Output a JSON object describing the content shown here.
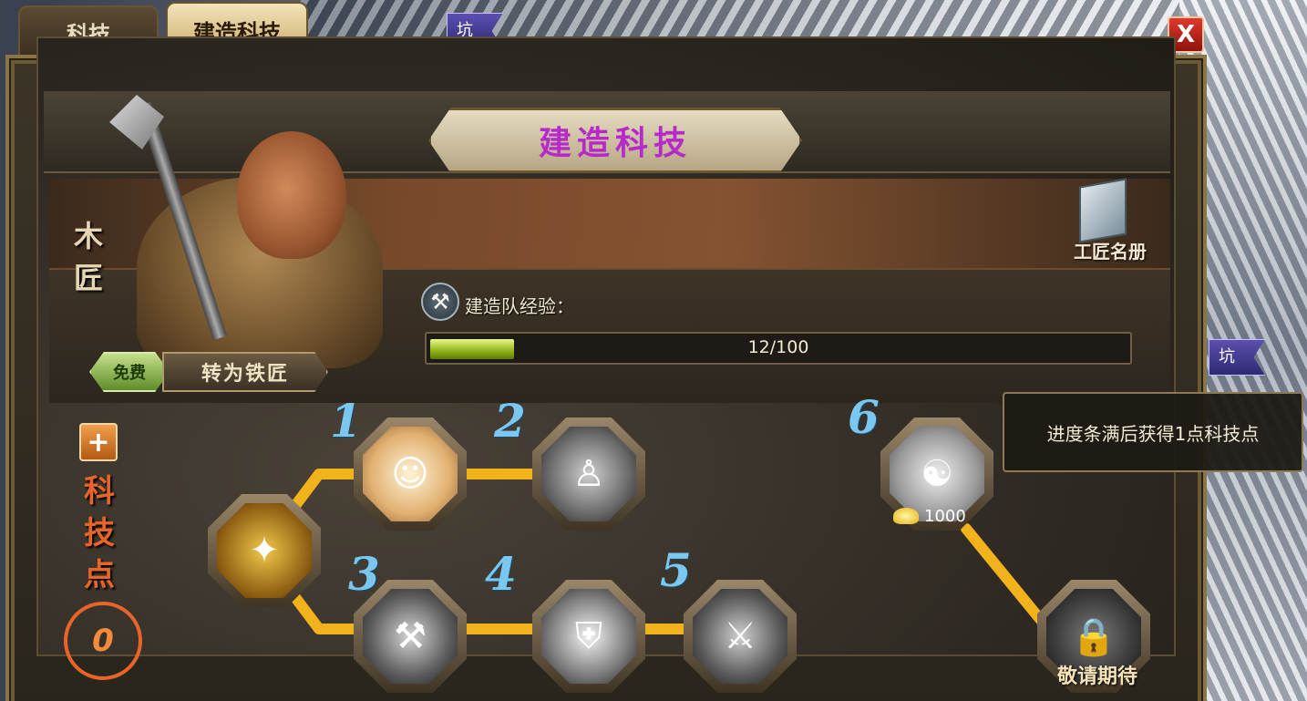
{
  "tabs": [
    {
      "label": "科技",
      "active": false
    },
    {
      "label": "建造科技",
      "active": true
    }
  ],
  "close_label": "X",
  "map_flags": [
    "坑",
    "坑"
  ],
  "panel_title": "建造科技",
  "worker": {
    "job": "木匠",
    "free_badge": "免费",
    "switch_label": "转为铁匠"
  },
  "roster_label": "工匠名册",
  "experience": {
    "label": "建造队经验：",
    "current": 12,
    "max": 100,
    "text": "12/100"
  },
  "tech_points": {
    "plus": "+",
    "label": "科技点",
    "value": "0"
  },
  "tree": {
    "numbers": [
      "1",
      "2",
      "3",
      "4",
      "5",
      "6"
    ],
    "nodes": [
      {
        "id": "root",
        "icon": "golden-beast-armor-icon"
      },
      {
        "id": "n1",
        "icon": "couple-portrait-icon"
      },
      {
        "id": "n2",
        "icon": "officials-group-icon"
      },
      {
        "id": "n3",
        "icon": "stone-hammer-icon"
      },
      {
        "id": "n4",
        "icon": "shield-icon"
      },
      {
        "id": "n5",
        "icon": "battering-ram-icon"
      },
      {
        "id": "n6",
        "icon": "dragon-coin-icon"
      },
      {
        "id": "locked",
        "icon": "chained-lock-icon"
      }
    ],
    "node6_cost": "1000",
    "locked_label": "敬请期待"
  },
  "tooltip": "进度条满后获得1点科技点",
  "colors": {
    "title_purple": "#b52ac9",
    "tech_point_orange": "#e8642a",
    "path_gold": "#f2b21c",
    "number_blue": "#7cc7f0",
    "exp_green": "#8fb317"
  }
}
